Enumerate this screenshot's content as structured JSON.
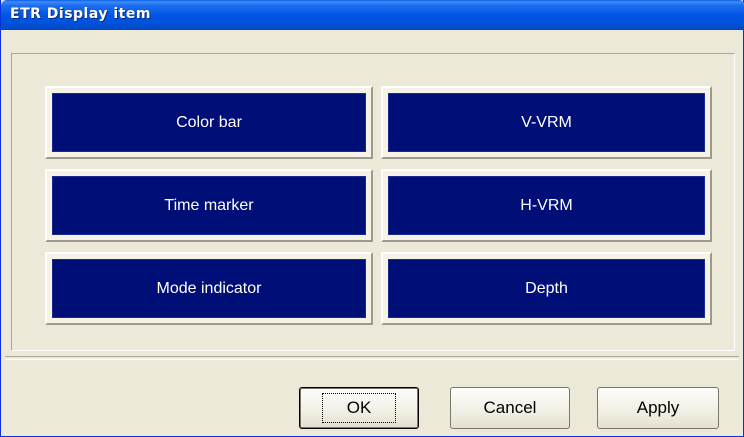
{
  "window": {
    "title": "ETR Display item"
  },
  "items": [
    {
      "label": "Color bar"
    },
    {
      "label": "V-VRM"
    },
    {
      "label": "Time marker"
    },
    {
      "label": "H-VRM"
    },
    {
      "label": "Mode indicator"
    },
    {
      "label": "Depth"
    }
  ],
  "buttons": {
    "ok": "OK",
    "cancel": "Cancel",
    "apply": "Apply"
  },
  "colors": {
    "item_background": "#000e78",
    "titlebar": "#0055e5",
    "dialog_face": "#ece9d8"
  }
}
